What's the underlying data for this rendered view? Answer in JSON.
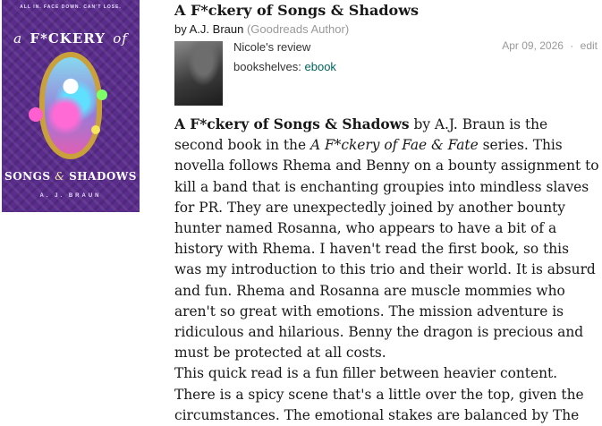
{
  "book": {
    "title": "A F*ckery of Songs & Shadows",
    "by_label": "by",
    "author": "A.J. Braun",
    "author_role": "(Goodreads Author)"
  },
  "cover": {
    "tagline": "ALL IN. FACE DOWN. CAN'T LOSE.",
    "title_pre": "a",
    "title_main": "F*CKERY",
    "title_post": "of",
    "title_bottom_a": "SONGS",
    "title_bottom_amp": "&",
    "title_bottom_b": "SHADOWS",
    "author": "A. J. BRAUN"
  },
  "review": {
    "reviewer_name": "Nicole's review",
    "shelves_label": "bookshelves:",
    "shelf": "ebook",
    "date": "Apr 09, 2026",
    "separator": "·",
    "edit_label": "edit",
    "p1_title": "A F*ckery of Songs & Shadows",
    "p1_text1": " by A.J. Braun is the second book in the ",
    "p1_series": "A F*ckery of Fae & Fate",
    "p1_text2": " series. This novella follows Rhema and Benny on a bounty assignment to kill a band that is enchanting groupies into mindless slaves for PR. They are unexpectedly joined by another bounty hunter named Rosanna, who appears to have a bit of a history with Rhema. I haven't read the first book, so this was my introduction to this trio and their world. It is absurd and fun. Rhema and Rosanna are muscle mommies who aren't so great with emotions. The mission adventure is ridiculous and hilarious. Benny the dragon is precious and must be protected at all costs.",
    "p2_text": "This quick read is a fun filler between heavier content. There is a spicy scene that's a little over the top, given the circumstances. The emotional stakes are balanced by The"
  }
}
